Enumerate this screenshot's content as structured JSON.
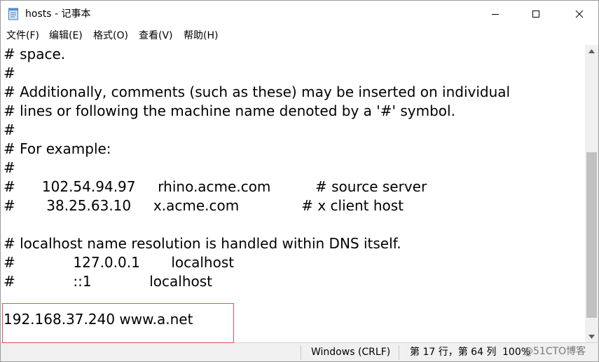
{
  "window": {
    "title": "hosts - 记事本",
    "app_icon": "notepad-icon",
    "controls": {
      "minimize": "minimize-icon",
      "maximize": "maximize-icon",
      "close": "close-icon"
    }
  },
  "menu": [
    "文件(F)",
    "编辑(E)",
    "格式(O)",
    "查看(V)",
    "帮助(H)"
  ],
  "editor": {
    "lines": [
      "# space.",
      "#",
      "# Additionally, comments (such as these) may be inserted on individual",
      "# lines or following the machine name denoted by a '#' symbol.",
      "#",
      "# For example:",
      "#",
      "#      102.54.94.97     rhino.acme.com          # source server",
      "#       38.25.63.10     x.acme.com              # x client host",
      "",
      "# localhost name resolution is handled within DNS itself.",
      "#             127.0.0.1       localhost",
      "#             ::1             localhost",
      "",
      "192.168.37.240 www.a.net"
    ]
  },
  "status": {
    "line_ending": "Windows (CRLF)",
    "position": "第 17 行，第 64 列",
    "zoom": "100%"
  },
  "watermark": "@51CTO博客",
  "colors": {
    "highlight_border": "#d9534f",
    "scroll_thumb": "#c1c1c1",
    "statusbar_bg": "#f0f0f0"
  }
}
